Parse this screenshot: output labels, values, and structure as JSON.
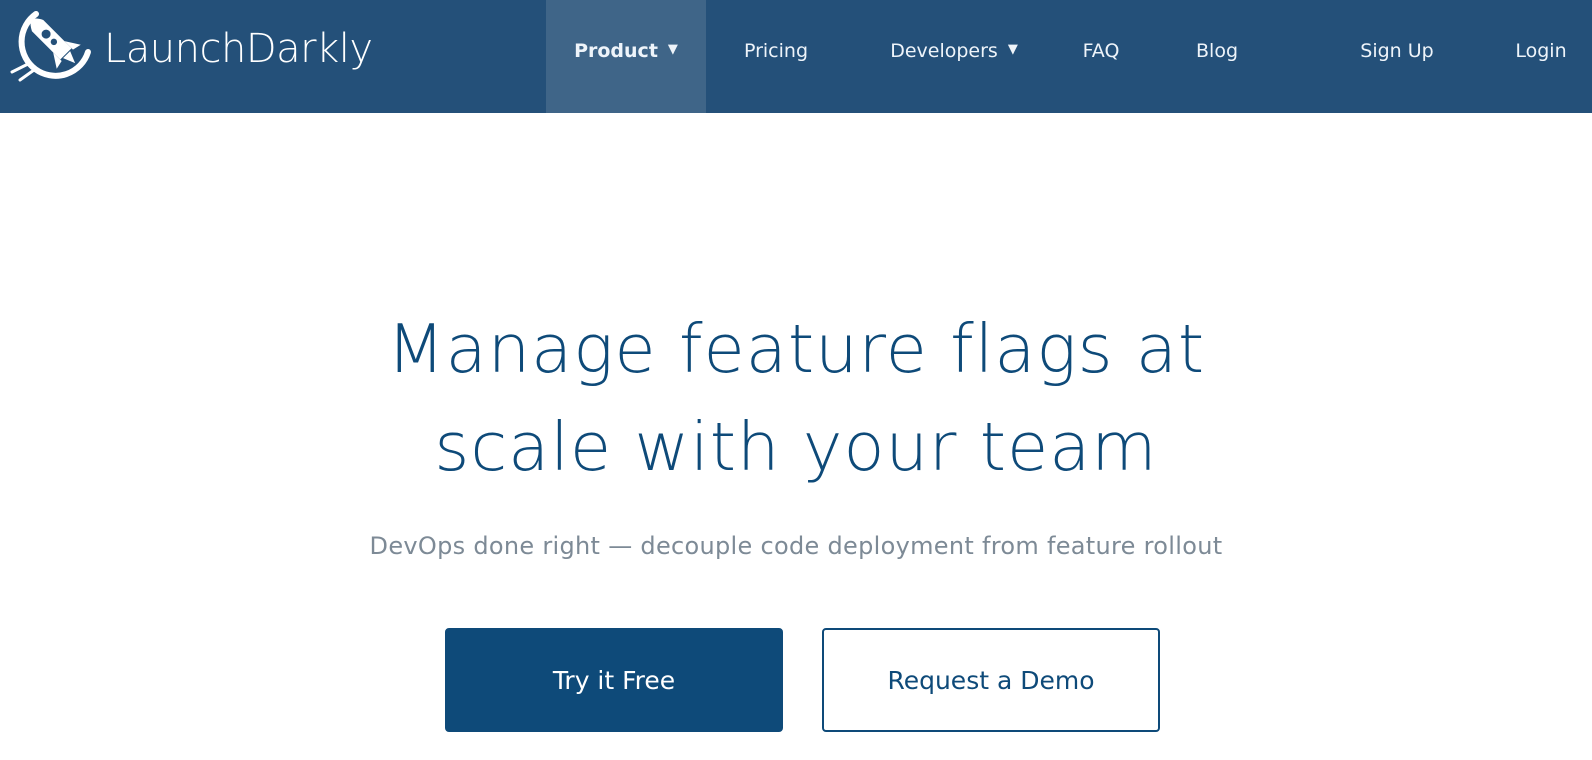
{
  "brand": {
    "name": "LaunchDarkly",
    "logo_icon": "rocket-icon"
  },
  "nav": {
    "items": [
      {
        "label": "Product",
        "has_dropdown": true,
        "active": true
      },
      {
        "label": "Pricing",
        "has_dropdown": false,
        "active": false
      },
      {
        "label": "Developers",
        "has_dropdown": true,
        "active": false
      },
      {
        "label": "FAQ",
        "has_dropdown": false,
        "active": false
      },
      {
        "label": "Blog",
        "has_dropdown": false,
        "active": false
      },
      {
        "label": "Sign Up",
        "has_dropdown": false,
        "active": false
      },
      {
        "label": "Login",
        "has_dropdown": false,
        "active": false
      }
    ],
    "caret": "▼"
  },
  "hero": {
    "title_line1": "Manage feature flags at",
    "title_line2": "scale with your team",
    "subtitle": "DevOps done right — decouple code deployment from feature rollout",
    "primary_cta": "Try it Free",
    "secondary_cta": "Request a Demo"
  },
  "colors": {
    "nav_background": "#245079",
    "nav_active": "#3f6588",
    "brand_primary": "#0e4a79",
    "subtitle_text": "#7d8a96",
    "background": "#ffffff"
  }
}
